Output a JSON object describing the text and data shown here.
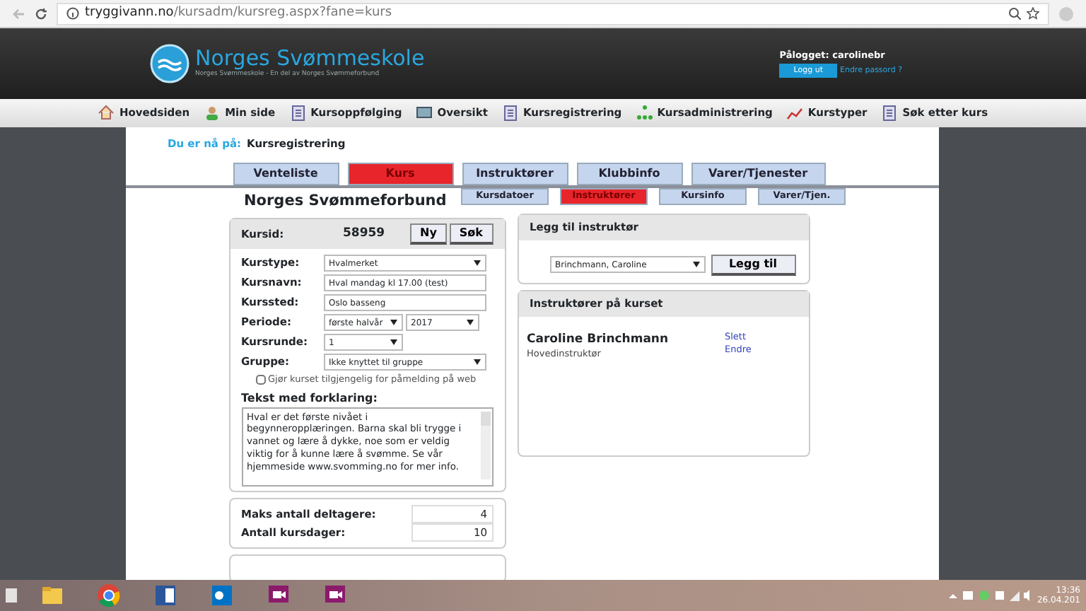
{
  "browser": {
    "url_host": "tryggivann.no",
    "url_path": "/kursadm/kursreg.aspx?fane=kurs"
  },
  "header": {
    "logo_title": "Norges Svømmeskole",
    "logo_tagline": "Norges Svømmeskole - En del av Norges Svømmeforbund",
    "logged_in_label": "Pålogget:",
    "logged_in_user": "carolinebr",
    "logout": "Logg ut",
    "change_password": "Endre passord ?"
  },
  "nav": [
    {
      "label": "Hovedsiden"
    },
    {
      "label": "Min side"
    },
    {
      "label": "Kursoppfølging"
    },
    {
      "label": "Oversikt"
    },
    {
      "label": "Kursregistrering"
    },
    {
      "label": "Kursadministrering"
    },
    {
      "label": "Kurstyper"
    },
    {
      "label": "Søk etter kurs"
    }
  ],
  "breadcrumb": {
    "label": "Du er nå på:",
    "page": "Kursregistrering"
  },
  "tabs": [
    {
      "label": "Venteliste",
      "selected": false
    },
    {
      "label": "Kurs",
      "selected": true
    },
    {
      "label": "Instruktører",
      "selected": false
    },
    {
      "label": "Klubbinfo",
      "selected": false
    },
    {
      "label": "Varer/Tjenester",
      "selected": false
    }
  ],
  "subtabs": [
    {
      "label": "Kursdatoer",
      "selected": false
    },
    {
      "label": "Instruktører",
      "selected": true
    },
    {
      "label": "Kursinfo",
      "selected": false
    },
    {
      "label": "Varer/Tjen.",
      "selected": false
    }
  ],
  "org_title": "Norges Svømmeforbund",
  "course": {
    "id_label": "Kursid:",
    "id": "58959",
    "buttons": [
      "Ny",
      "Søk"
    ],
    "fields": [
      {
        "label": "Kurstype:",
        "kind": "select",
        "value": "Hvalmerket"
      },
      {
        "label": "Kursnavn:",
        "kind": "text",
        "value": "Hval mandag kl 17.00 (test)"
      },
      {
        "label": "Kurssted:",
        "kind": "text",
        "value": "Oslo basseng"
      },
      {
        "label": "Periode:",
        "kind": "select2",
        "value": "første halvår",
        "value2": "2017"
      },
      {
        "label": "Kursrunde:",
        "kind": "selectsmall",
        "value": "1"
      },
      {
        "label": "Gruppe:",
        "kind": "select",
        "value": "Ikke knyttet til gruppe"
      }
    ],
    "web_checkbox": {
      "label": "Gjør kurset tilgjengelig for påmelding på web",
      "checked": false
    },
    "description_label": "Tekst med forklaring:",
    "description": "Hval er det første nivået i begynneropplæringen. Barna skal bli trygge i vannet og lære å dykke, noe som er veldig viktig for å kunne lære å svømme. Se vår hjemmeside www.svomming.no for mer info."
  },
  "limits": [
    {
      "label": "Maks antall deltagere:",
      "value": "4"
    },
    {
      "label": "Antall kursdager:",
      "value": "10"
    }
  ],
  "add_instructor": {
    "title": "Legg til instruktør",
    "selected": "Brinchmann, Caroline",
    "button": "Legg til"
  },
  "instructors": {
    "title": "Instruktører på kurset",
    "items": [
      {
        "name": "Caroline Brinchmann",
        "role": "Hovedinstruktør",
        "actions": [
          "Slett",
          "Endre"
        ]
      }
    ]
  },
  "taskbar": {
    "apps": [
      {
        "kind": "folder"
      },
      {
        "kind": "chrome"
      },
      {
        "kind": "word"
      },
      {
        "kind": "outlook"
      },
      {
        "kind": "video"
      },
      {
        "kind": "video"
      }
    ],
    "time": "13:36",
    "date": "26.04.201"
  }
}
